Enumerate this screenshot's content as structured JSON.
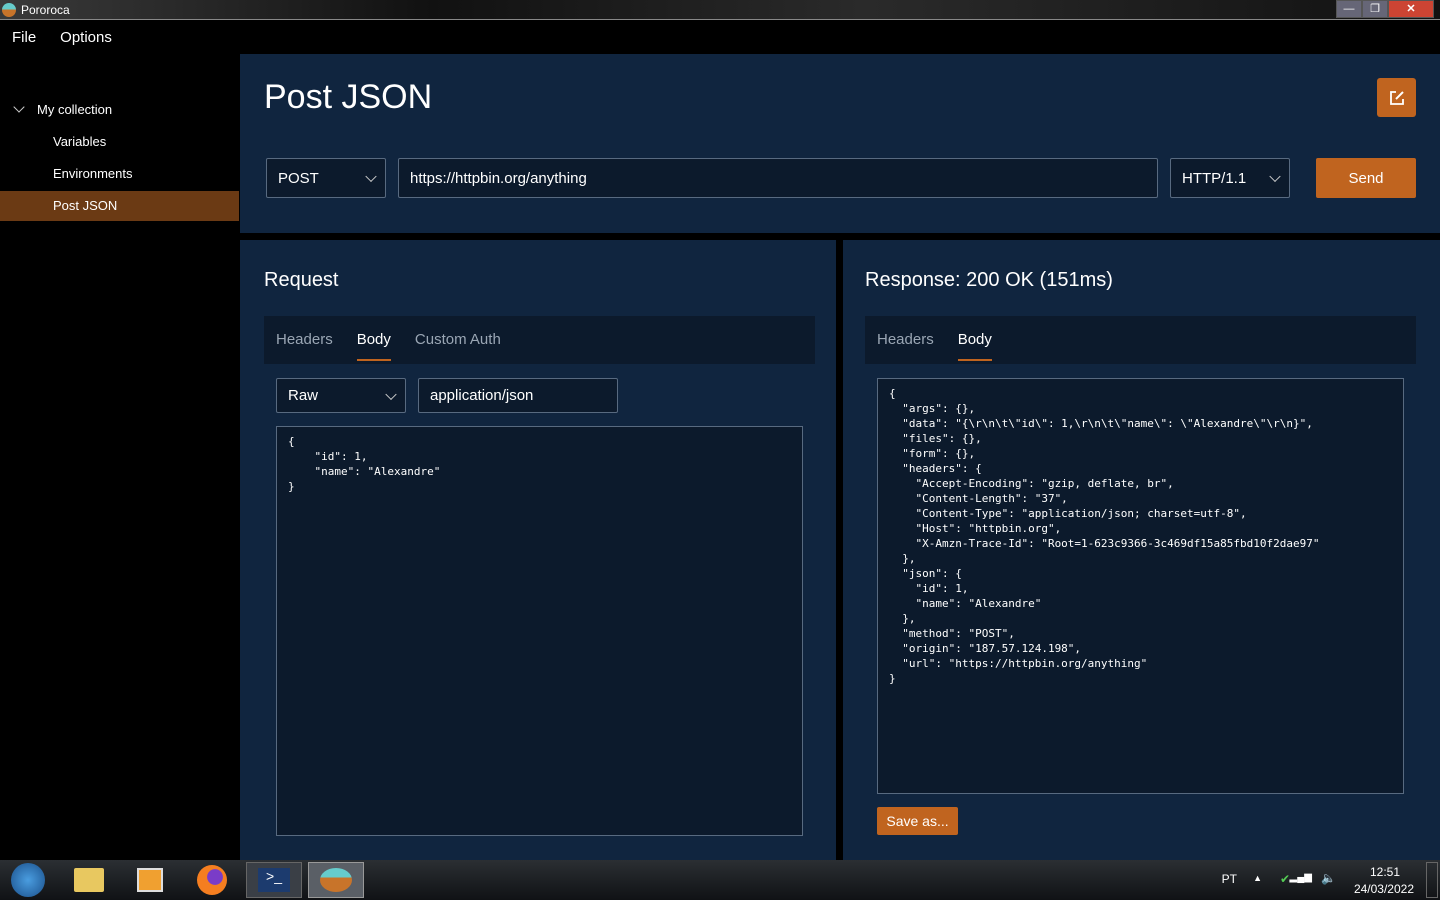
{
  "window": {
    "title": "Pororoca",
    "min": "—",
    "max": "❐",
    "close": "✕"
  },
  "menu": [
    "File",
    "Options"
  ],
  "sidebar": {
    "collection": "My collection",
    "items": [
      "Variables",
      "Environments",
      "Post JSON"
    ],
    "selected": "Post JSON"
  },
  "request_header": {
    "title": "Post JSON",
    "method": "POST",
    "url": "https://httpbin.org/anything",
    "http_version": "HTTP/1.1",
    "send_label": "Send"
  },
  "request": {
    "title": "Request",
    "tabs": [
      "Headers",
      "Body",
      "Custom Auth"
    ],
    "active_tab": "Body",
    "body_mode": "Raw",
    "content_type": "application/json",
    "body": "{\n    \"id\": 1,\n    \"name\": \"Alexandre\"\n}"
  },
  "response": {
    "title": "Response: 200 OK (151ms)",
    "tabs": [
      "Headers",
      "Body"
    ],
    "active_tab": "Body",
    "save_label": "Save as...",
    "body": "{\n  \"args\": {},\n  \"data\": \"{\\r\\n\\t\\\"id\\\": 1,\\r\\n\\t\\\"name\\\": \\\"Alexandre\\\"\\r\\n}\",\n  \"files\": {},\n  \"form\": {},\n  \"headers\": {\n    \"Accept-Encoding\": \"gzip, deflate, br\",\n    \"Content-Length\": \"37\",\n    \"Content-Type\": \"application/json; charset=utf-8\",\n    \"Host\": \"httpbin.org\",\n    \"X-Amzn-Trace-Id\": \"Root=1-623c9366-3c469df15a85fbd10f2dae97\"\n  },\n  \"json\": {\n    \"id\": 1,\n    \"name\": \"Alexandre\"\n  },\n  \"method\": \"POST\",\n  \"origin\": \"187.57.124.198\",\n  \"url\": \"https://httpbin.org/anything\"\n}"
  },
  "taskbar": {
    "language": "PT",
    "time": "12:51",
    "date": "24/03/2022"
  },
  "colors": {
    "accent": "#c0641f",
    "panel": "#10253f",
    "selected": "#6b3a14"
  }
}
